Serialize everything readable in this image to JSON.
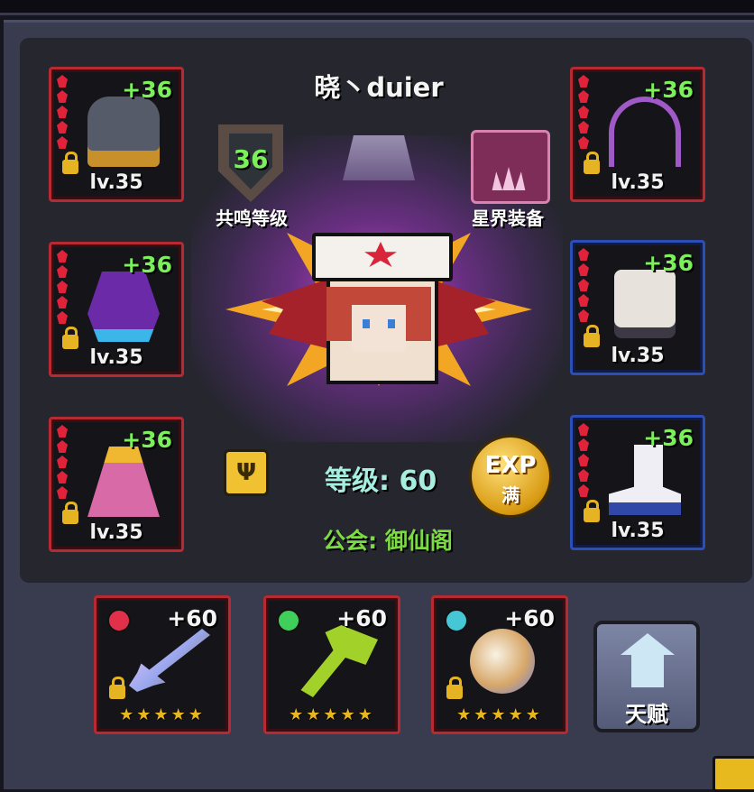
{
  "player": {
    "name": "晓丶duier",
    "level_label": "等级: 60",
    "guild_label": "公会: 御仙阁"
  },
  "resonance": {
    "value": "36",
    "label": "共鸣等级"
  },
  "astral": {
    "label": "星界装备"
  },
  "exp": {
    "label": "EXP",
    "status": "满"
  },
  "equipment": [
    {
      "name": "helmet",
      "plus": "+36",
      "level": "lv.35",
      "frame": "red"
    },
    {
      "name": "cloak",
      "plus": "+36",
      "level": "lv.35",
      "frame": "red"
    },
    {
      "name": "robe",
      "plus": "+36",
      "level": "lv.35",
      "frame": "red"
    },
    {
      "name": "amulet",
      "plus": "+36",
      "level": "lv.35",
      "frame": "red"
    },
    {
      "name": "dice",
      "plus": "+36",
      "level": "lv.35",
      "frame": "blue"
    },
    {
      "name": "boots",
      "plus": "+36",
      "level": "lv.35",
      "frame": "blue"
    }
  ],
  "weapons": [
    {
      "name": "sword",
      "plus": "+60",
      "stars": "★★★★★",
      "orb_color": "#e0304a"
    },
    {
      "name": "axe",
      "plus": "+60",
      "stars": "★★★★★",
      "orb_color": "#3fcf5a"
    },
    {
      "name": "orb",
      "plus": "+60",
      "stars": "★★★★★",
      "orb_color": "#45c7d6"
    }
  ],
  "talent": {
    "label": "天赋"
  },
  "gold_icon_glyph": "Ψ",
  "colors": {
    "plus_green": "#7bf05a",
    "frame_red": "#b52a33",
    "frame_blue": "#2d4fb5",
    "gold": "#e8b61e"
  }
}
